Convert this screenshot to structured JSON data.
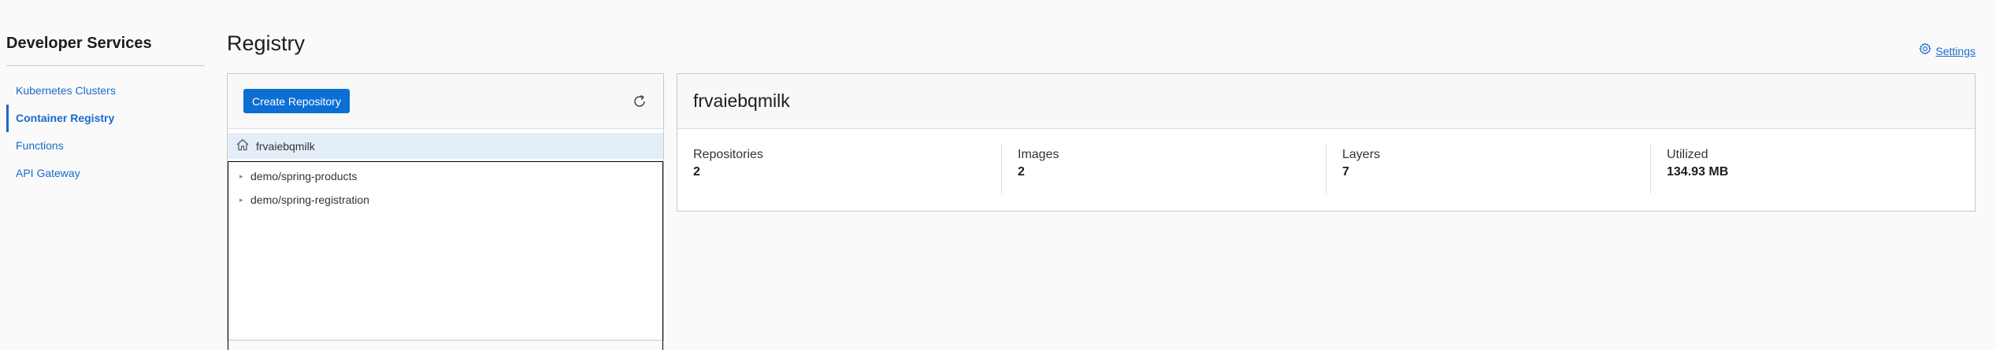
{
  "sidebar": {
    "title": "Developer Services",
    "items": [
      {
        "label": "Kubernetes Clusters",
        "active": false
      },
      {
        "label": "Container Registry",
        "active": true
      },
      {
        "label": "Functions",
        "active": false
      },
      {
        "label": "API Gateway",
        "active": false
      }
    ]
  },
  "page": {
    "title": "Registry",
    "settings_label": "Settings"
  },
  "tree": {
    "create_button_label": "Create Repository",
    "root": "frvaiebqmilk",
    "repositories": [
      "demo/spring-products",
      "demo/spring-registration"
    ]
  },
  "details": {
    "title": "frvaiebqmilk",
    "metrics": [
      {
        "label": "Repositories",
        "value": "2"
      },
      {
        "label": "Images",
        "value": "2"
      },
      {
        "label": "Layers",
        "value": "7"
      },
      {
        "label": "Utilized",
        "value": "134.93 MB"
      }
    ]
  },
  "colors": {
    "accent": "#1b6ac9",
    "primary_button": "#0b6fd4",
    "selected_row": "#e3eef9"
  },
  "icons": {
    "settings": "gear-icon",
    "refresh": "refresh-icon",
    "root": "home-icon",
    "tree_expand": "caret-right-icon"
  }
}
